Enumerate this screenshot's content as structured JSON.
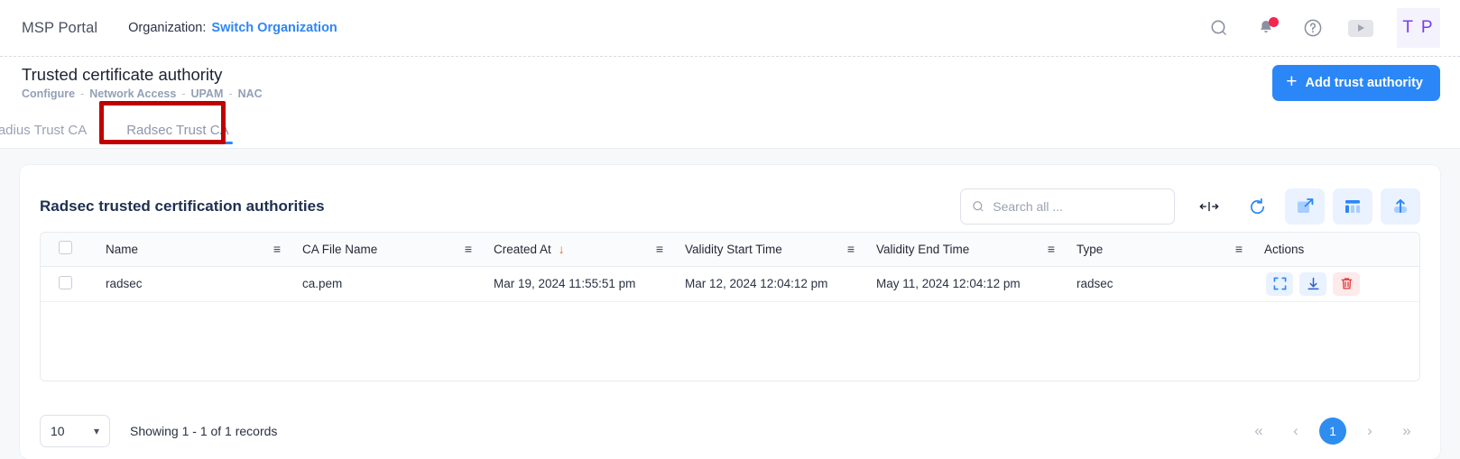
{
  "topbar": {
    "brand": "MSP Portal",
    "org_label": "Organization:",
    "org_link": "Switch Organization",
    "icons": {
      "search": "search-icon",
      "notifications": "bell-icon",
      "help": "help-circle-icon",
      "video": "play-icon"
    },
    "avatar_initials": "T P"
  },
  "page": {
    "title": "Trusted certificate authority",
    "breadcrumb": [
      "Configure",
      "Network Access",
      "UPAM",
      "NAC"
    ],
    "breadcrumb_sep": "-",
    "add_button": "Add trust authority"
  },
  "tabs": [
    {
      "label": "Radius Trust CA",
      "active": false
    },
    {
      "label": "Radsec Trust CA",
      "active": true
    }
  ],
  "card": {
    "title": "Radsec trusted certification authorities",
    "search_placeholder": "Search all ...",
    "search_value": "",
    "tools": [
      {
        "name": "fit-columns-icon"
      },
      {
        "name": "refresh-icon"
      },
      {
        "name": "expand-icon"
      },
      {
        "name": "columns-icon"
      },
      {
        "name": "export-icon"
      }
    ]
  },
  "table": {
    "columns": [
      "Name",
      "CA File Name",
      "Created At",
      "Validity Start Time",
      "Validity End Time",
      "Type",
      "Actions"
    ],
    "sorted_column": "Created At",
    "sort_direction": "↓",
    "rows": [
      {
        "name": "radsec",
        "ca_file_name": "ca.pem",
        "created_at": "Mar 19, 2024 11:55:51 pm",
        "validity_start": "Mar 12, 2024 12:04:12 pm",
        "validity_end": "May 11, 2024 12:04:12 pm",
        "type": "radsec",
        "actions": [
          "view-icon",
          "download-icon",
          "delete-icon"
        ]
      }
    ]
  },
  "footer": {
    "page_size": "10",
    "showing": "Showing 1 - 1 of 1 records",
    "pager": {
      "first": "«",
      "prev": "‹",
      "current": "1",
      "next": "›",
      "last": "»"
    }
  },
  "colors": {
    "accent": "#2b87f7",
    "danger": "#e23b3b",
    "highlight_box": "#c00000",
    "notification_dot": "#f5254f"
  }
}
